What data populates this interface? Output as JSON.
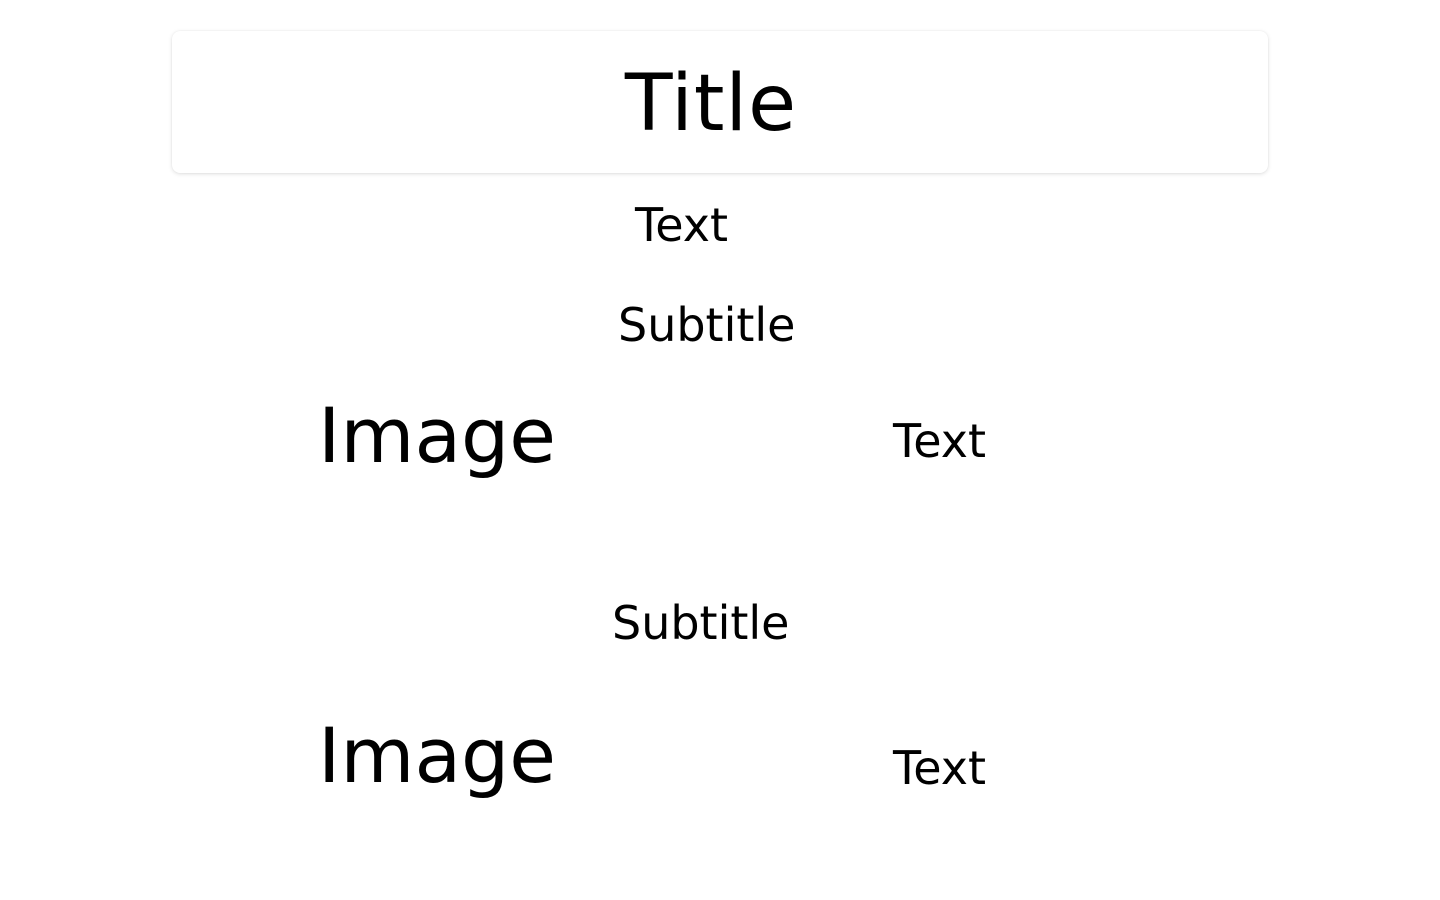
{
  "header": {
    "title": "Title"
  },
  "intro": {
    "text": "Text"
  },
  "sections": [
    {
      "subtitle": "Subtitle",
      "image_label": "Image",
      "text": "Text"
    },
    {
      "subtitle": "Subtitle",
      "image_label": "Image",
      "text": "Text"
    }
  ]
}
